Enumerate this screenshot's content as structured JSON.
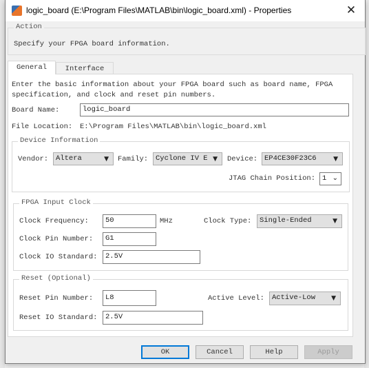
{
  "window": {
    "title": "logic_board (E:\\Program Files\\MATLAB\\bin\\logic_board.xml) - Properties",
    "close_icon": "close-icon",
    "app_icon": "matlab-icon"
  },
  "action": {
    "label": "Action",
    "text": "Specify your FPGA board information."
  },
  "tabs": [
    {
      "label": "General",
      "active": true
    },
    {
      "label": "Interface",
      "active": false
    }
  ],
  "general": {
    "description": "Enter the basic information about your FPGA board such as board name, FPGA specification, and clock and reset pin numbers.",
    "board_name_label": "Board Name:",
    "board_name": "logic_board",
    "file_location_label": "File Location:",
    "file_location": "E:\\Program Files\\MATLAB\\bin\\logic_board.xml",
    "device": {
      "label": "Device Information",
      "vendor_label": "Vendor:",
      "vendor": "Altera",
      "family_label": "Family:",
      "family": "Cyclone IV E",
      "device_label": "Device:",
      "device": "EP4CE30F23C6",
      "jtag_label": "JTAG Chain Position:",
      "jtag": "1"
    },
    "clock": {
      "label": "FPGA Input Clock",
      "freq_label": "Clock Frequency:",
      "freq": "50",
      "unit": "MHz",
      "type_label": "Clock Type:",
      "type": "Single-Ended",
      "pin_label": "Clock Pin Number:",
      "pin": "G1",
      "io_label": "Clock IO Standard:",
      "io": "2.5V"
    },
    "reset": {
      "label": "Reset (Optional)",
      "pin_label": "Reset Pin Number:",
      "pin": "L8",
      "level_label": "Active Level:",
      "level": "Active-Low",
      "io_label": "Reset IO Standard:",
      "io": "2.5V"
    }
  },
  "buttons": {
    "ok": "OK",
    "cancel": "Cancel",
    "help": "Help",
    "apply": "Apply"
  },
  "colors": {
    "focus": "#0078d7"
  }
}
